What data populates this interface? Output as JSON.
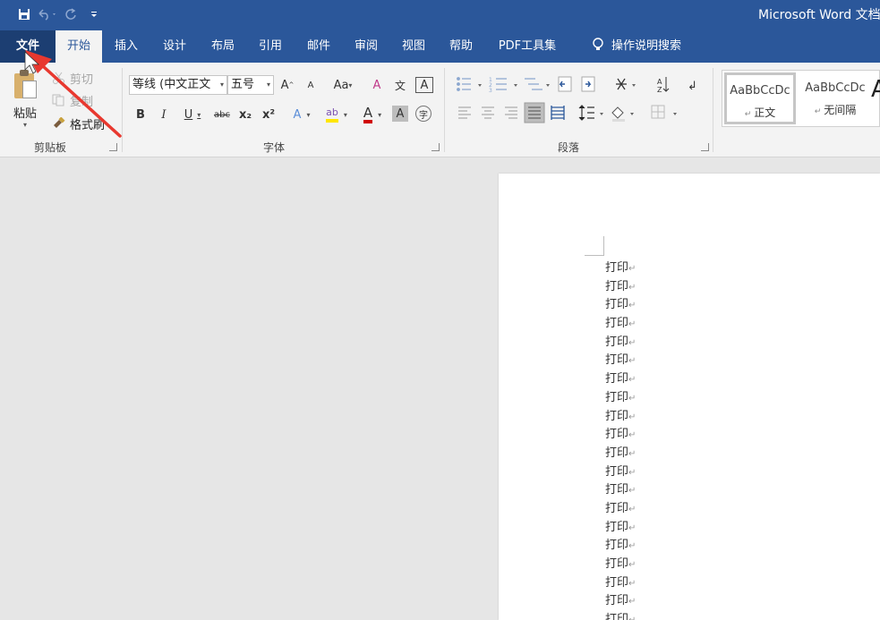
{
  "qat": {
    "save_icon": "save-icon",
    "undo_icon": "undo-icon",
    "redo_icon": "redo-icon",
    "customize_icon": "customize-qat-icon"
  },
  "title": "Microsoft Word 文档.",
  "tabs": {
    "file": "文件",
    "home": "开始",
    "insert": "插入",
    "design": "设计",
    "layout": "布局",
    "references": "引用",
    "mailings": "邮件",
    "review": "审阅",
    "view": "视图",
    "help": "帮助",
    "pdf": "PDF工具集",
    "tell_me": "操作说明搜索"
  },
  "clipboard": {
    "paste": "粘贴",
    "cut": "剪切",
    "copy": "复制",
    "format_painter": "格式刷",
    "group_label": "剪贴板"
  },
  "font": {
    "font_name": "等线 (中文正文",
    "font_size": "五号",
    "grow": "A",
    "shrink": "A",
    "change_case": "Aa",
    "clear_format": "A",
    "phonetic": "文",
    "char_border": "A",
    "bold": "B",
    "italic": "I",
    "underline": "U",
    "strike": "abc",
    "subscript": "x₂",
    "superscript": "x²",
    "text_effect": "A",
    "highlight": "ab",
    "font_color": "A",
    "char_shading": "A",
    "enclose": "字",
    "group_label": "字体"
  },
  "paragraph": {
    "group_label": "段落"
  },
  "styles": {
    "items": [
      {
        "sample": "AaBbCcDc",
        "name": "正文"
      },
      {
        "sample": "AaBbCcDc",
        "name": "无间隔"
      }
    ],
    "next_sample": "A"
  },
  "document": {
    "lines": [
      "打印",
      "打印",
      "打印",
      "打印",
      "打印",
      "打印",
      "打印",
      "打印",
      "打印",
      "打印",
      "打印",
      "打印",
      "打印",
      "打印",
      "打印",
      "打印",
      "打印",
      "打印",
      "打印",
      "打印"
    ],
    "paragraph_mark": "↵"
  },
  "colors": {
    "title_bar": "#2b579a",
    "file_tab": "#1c3e72",
    "ribbon": "#f3f3f3",
    "annotation_arrow": "#e8382f",
    "highlight_yellow": "#ffe600",
    "font_red": "#d00000"
  }
}
